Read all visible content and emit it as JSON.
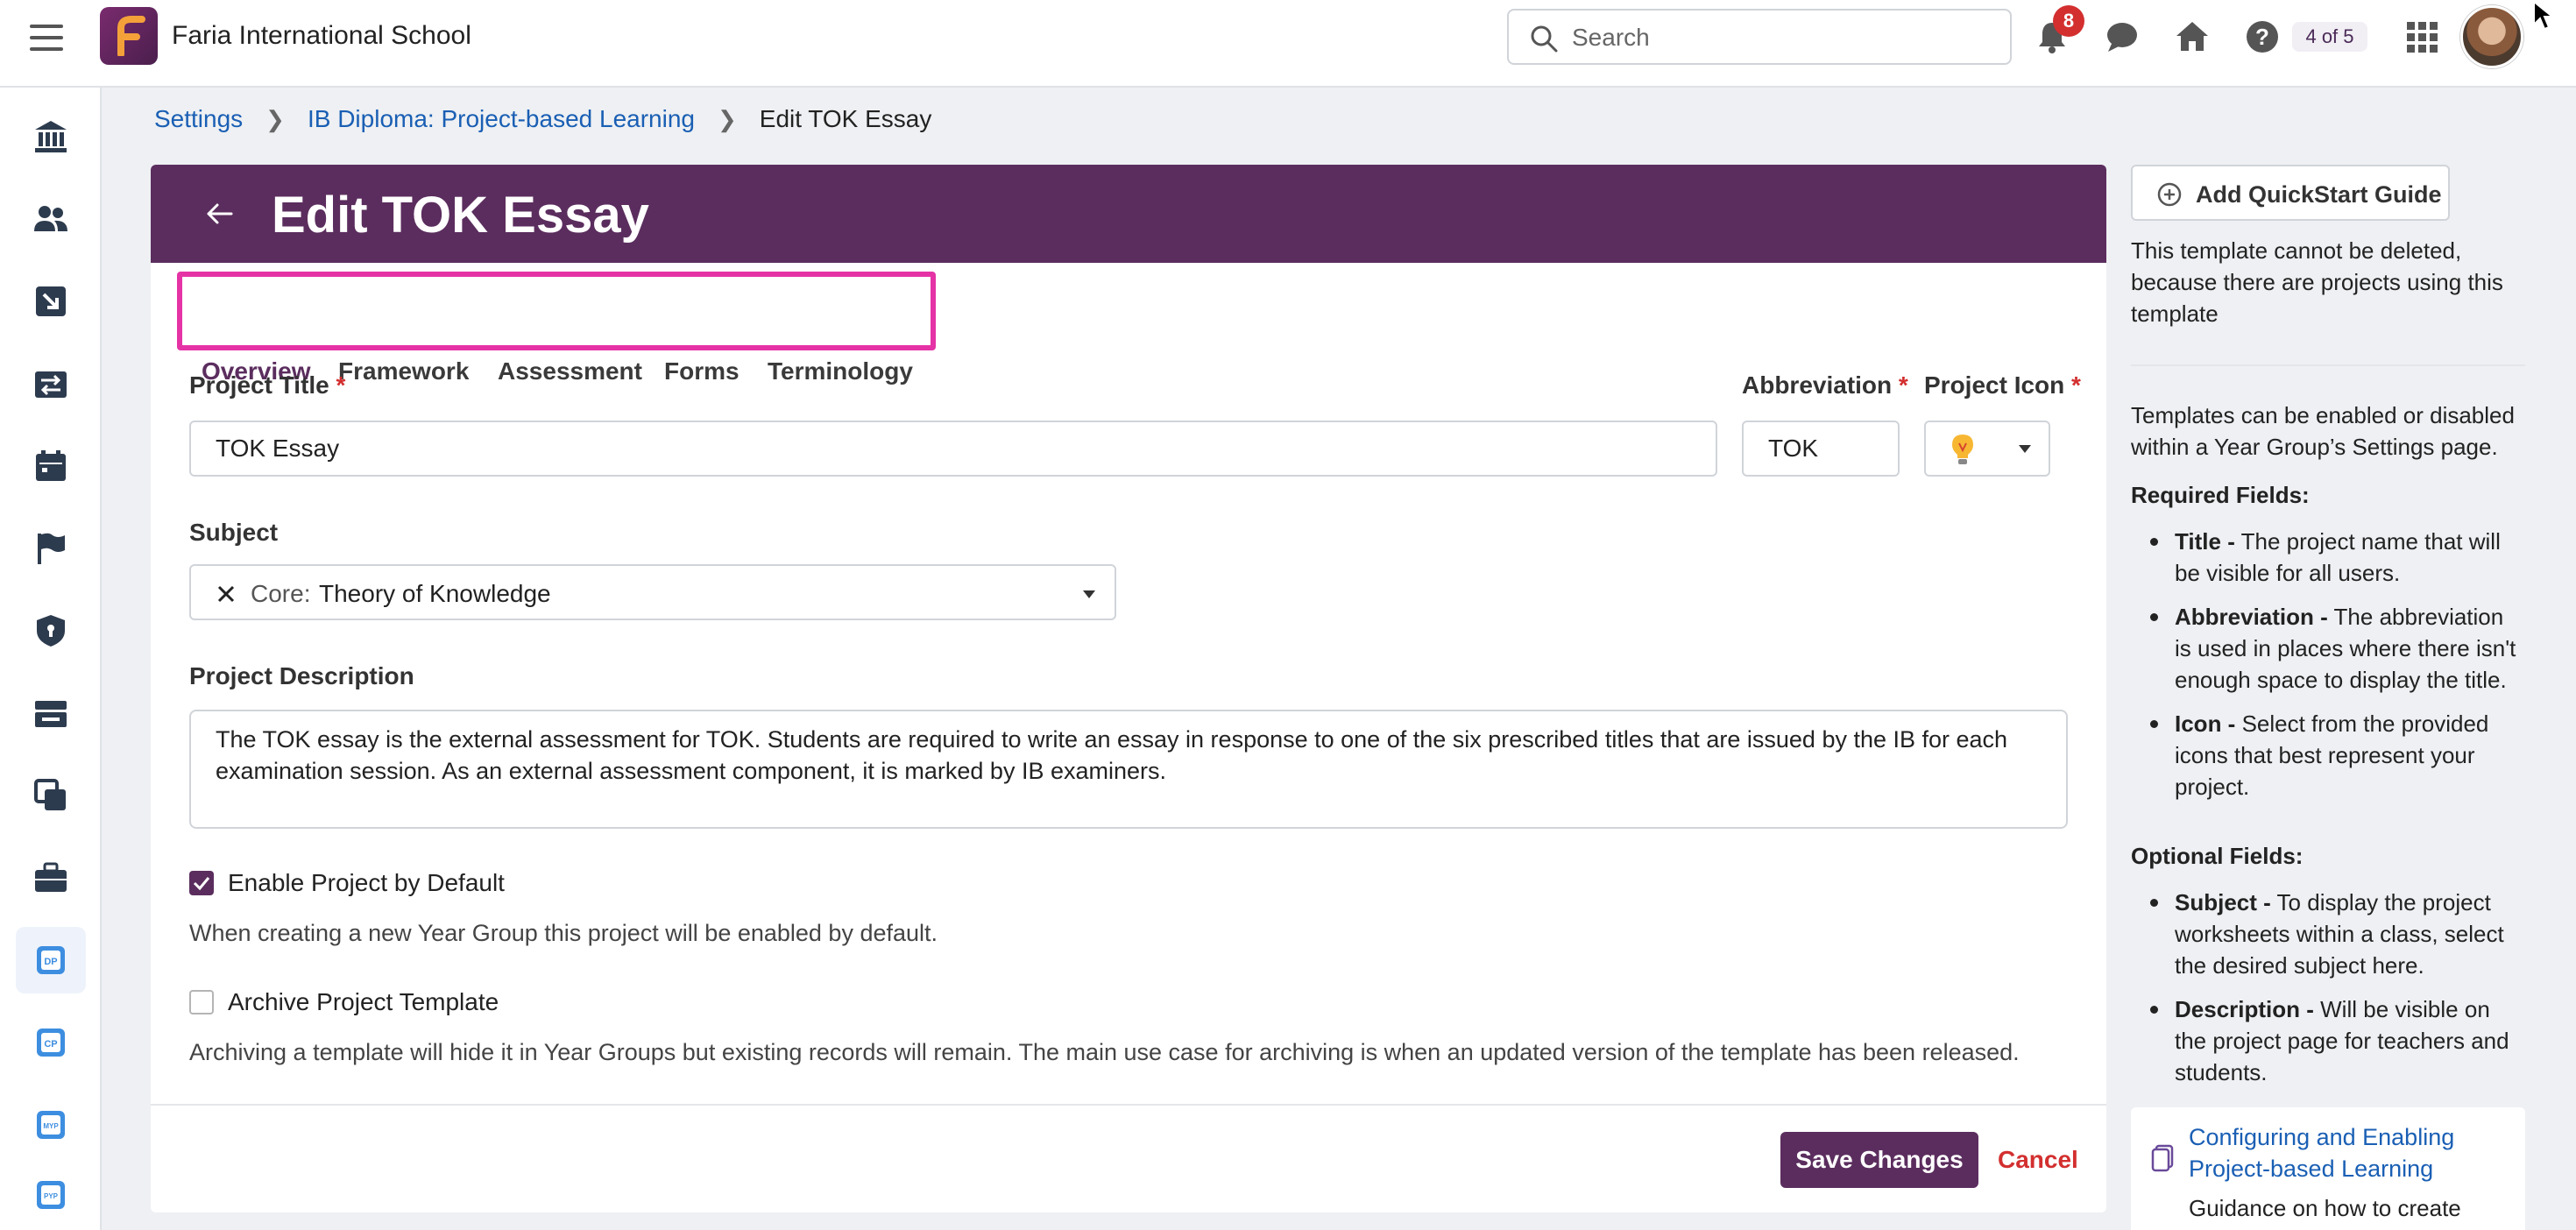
{
  "topbar": {
    "school_name": "Faria International School",
    "search_placeholder": "Search",
    "notification_count": "8",
    "page_count": "4 of 5"
  },
  "sidebar": {
    "items": [
      "institution-icon",
      "people-icon",
      "import-icon",
      "transfer-icon",
      "calendar-icon",
      "flag-icon",
      "shield-icon",
      "badge-icon",
      "copy-icon",
      "briefcase-icon",
      "dp-icon",
      "cp-icon",
      "myp-icon",
      "pyp-icon"
    ],
    "active_index": 10
  },
  "breadcrumb": {
    "items": [
      "Settings",
      "IB Diploma: Project-based Learning"
    ],
    "current": "Edit TOK Essay"
  },
  "header": {
    "title": "Edit TOK Essay"
  },
  "tabs": [
    "Overview",
    "Framework",
    "Assessment",
    "Forms",
    "Terminology"
  ],
  "form": {
    "project_title_label": "Project Title",
    "project_title_value": "TOK Essay",
    "abbreviation_label": "Abbreviation",
    "abbreviation_value": "TOK",
    "project_icon_label": "Project Icon",
    "project_icon": "lightbulb-icon",
    "subject_label": "Subject",
    "subject_prefix": "Core:",
    "subject_value": "Theory of Knowledge",
    "description_label": "Project Description",
    "description_value": "The TOK essay is the external assessment for TOK. Students are required to write an essay in response to one of the six prescribed titles that are issued by the IB for each examination session. As an external assessment component, it is marked by IB examiners.",
    "enable_label": "Enable Project by Default",
    "enable_checked": true,
    "enable_helper": "When creating a new Year Group this project will be enabled by default.",
    "archive_label": "Archive Project Template",
    "archive_checked": false,
    "archive_helper": "Archiving a template will hide it in Year Groups but existing records will remain. The main use case for archiving is when an updated version of the template has been released.",
    "save_label": "Save Changes",
    "cancel_label": "Cancel",
    "required_mark": "*"
  },
  "right_panel": {
    "quickstart_label": "Add QuickStart Guide",
    "delete_note": "This template cannot be deleted, because there are projects using this template",
    "enable_note": "Templates can be enabled or disabled within a Year Group’s Settings page.",
    "required_heading": "Required Fields:",
    "required_items": [
      {
        "term": "Title -",
        "text": " The project name that will be visible for all users."
      },
      {
        "term": "Abbreviation -",
        "text": " The abbreviation is used in places where there isn't enough space to display the title."
      },
      {
        "term": "Icon -",
        "text": " Select from the provided icons that best represent your project."
      }
    ],
    "optional_heading": "Optional Fields:",
    "optional_items": [
      {
        "term": "Subject -",
        "text": " To display the project worksheets within a class, select the desired subject here."
      },
      {
        "term": "Description -",
        "text": " Will be visible on the project page for teachers and students."
      }
    ],
    "guide_link": "Configuring and Enabling Project-based Learning",
    "guide_desc": "Guidance on how to create"
  },
  "colors": {
    "brand": "#5b2d5e",
    "highlight": "#e533a6",
    "link": "#1a5fb4",
    "danger": "#d32f2f"
  }
}
